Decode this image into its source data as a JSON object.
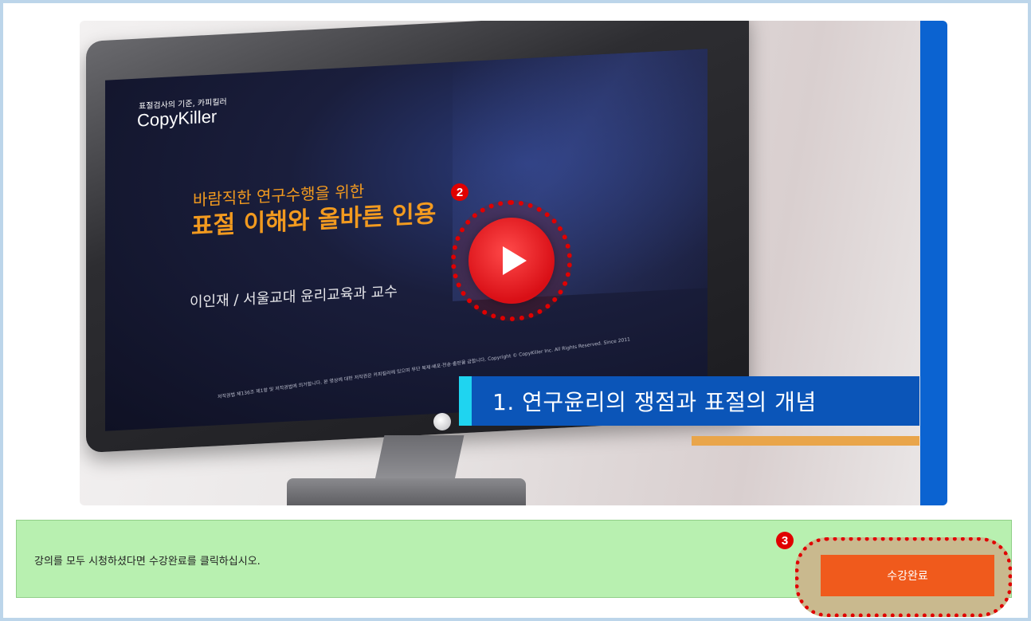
{
  "video": {
    "brand_small": "표절검사의 기준, 카피킬러",
    "brand_big": "CopyKiller",
    "subtitle": "바람직한 연구수행을 위한",
    "title": "표절 이해와 올바른 인용",
    "lecturer": "이인재 / 서울교대 윤리교육과 교수",
    "fine_print": "저작권법 제136조 제1항 및 저작권법에 의거합니다. 본 영상에 대한 저작권은 카피킬러에 있으며 무단 복제·배포·전송·출판을 금합니다. Copyright © CopyKiller Inc. All Rights Reserved. Since 2011",
    "chapter_title": "1. 연구윤리의 쟁점과 표절의 개념",
    "play_icon": "play-icon"
  },
  "markers": {
    "play": "2",
    "complete": "3"
  },
  "notice": {
    "text": "강의를 모두 시청하셨다면 수강완료를 클릭하십시오.",
    "button_label": "수강완료"
  },
  "colors": {
    "frame_border": "#bcd5ea",
    "notice_bg": "#b8f0b0",
    "button_bg": "#f05a1c",
    "chapter_bar": "#0b55b8",
    "highlight_red": "#e00000"
  }
}
